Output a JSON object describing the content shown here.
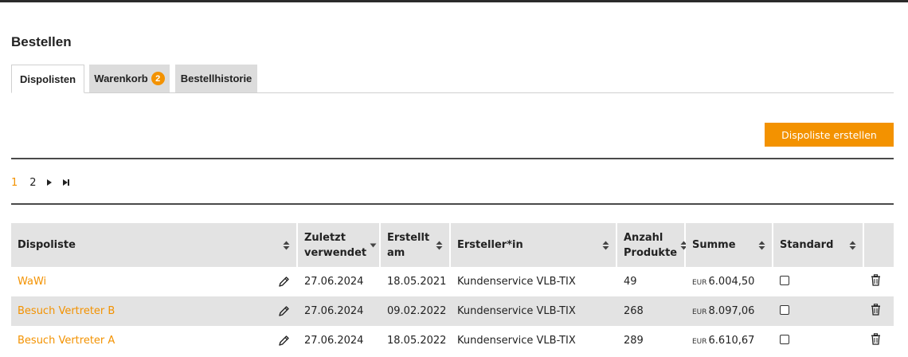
{
  "page": {
    "title": "Bestellen"
  },
  "tabs": [
    {
      "label": "Dispolisten",
      "active": true
    },
    {
      "label": "Warenkorb",
      "badge": "2",
      "active": false
    },
    {
      "label": "Bestellhistorie",
      "active": false
    }
  ],
  "actions": {
    "create_label": "Dispoliste erstellen"
  },
  "pagination": {
    "current": "1",
    "other": "2",
    "next_icon": "caret-right-icon",
    "last_icon": "skip-to-end-icon"
  },
  "table": {
    "columns": [
      {
        "label": "Dispoliste",
        "sort": "both"
      },
      {
        "label": "Zuletzt verwendet",
        "sort": "desc"
      },
      {
        "label": "Erstellt am",
        "sort": "both"
      },
      {
        "label": "Ersteller*in",
        "sort": "both"
      },
      {
        "label": "Anzahl Produkte",
        "sort": "both"
      },
      {
        "label": "Summe",
        "sort": "both"
      },
      {
        "label": "Standard",
        "sort": "both"
      },
      {
        "label": ""
      }
    ],
    "rows": [
      {
        "name": "WaWi",
        "last_used": "27.06.2024",
        "created": "18.05.2021",
        "creator": "Kundenservice VLB-TIX",
        "count": "49",
        "currency": "EUR",
        "sum": "6.004,50",
        "standard": false
      },
      {
        "name": "Besuch Vertreter B",
        "last_used": "27.06.2024",
        "created": "09.02.2022",
        "creator": "Kundenservice VLB-TIX",
        "count": "268",
        "currency": "EUR",
        "sum": "8.097,06",
        "standard": false
      },
      {
        "name": "Besuch Vertreter A",
        "last_used": "27.06.2024",
        "created": "18.05.2022",
        "creator": "Kundenservice VLB-TIX",
        "count": "289",
        "currency": "EUR",
        "sum": "6.610,67",
        "standard": false
      }
    ]
  },
  "colors": {
    "accent": "#f39200",
    "header_bg": "#e3e3e3",
    "text": "#222222"
  },
  "icons": {
    "edit": "pencil-icon",
    "delete": "trash-icon",
    "sort": "sort-icon"
  }
}
